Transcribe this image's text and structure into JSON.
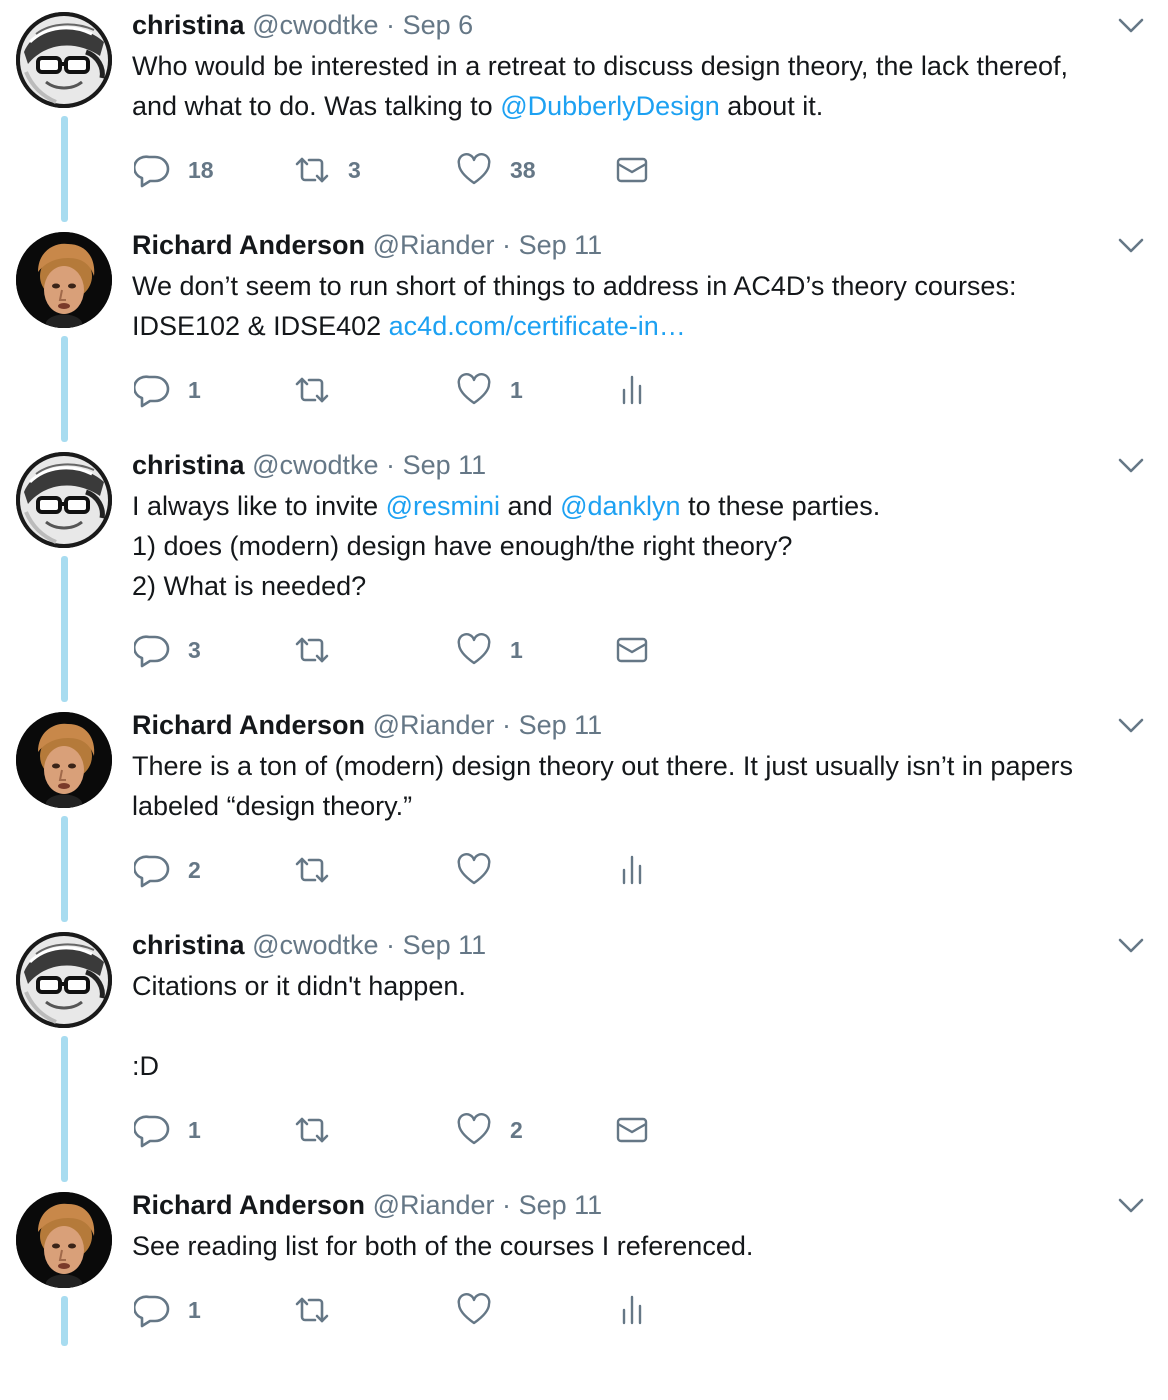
{
  "tweets": [
    {
      "avatar": "christina",
      "name": "christina",
      "handle": "@cwodtke",
      "sep": "·",
      "date": "Sep 6",
      "lines": [
        [
          {
            "t": "Who would be interested in a retreat to discuss design theory, the lack thereof,"
          }
        ],
        [
          {
            "t": "and what to do. Was talking to "
          },
          {
            "t": "@DubberlyDesign",
            "link": true
          },
          {
            "t": " about it."
          }
        ]
      ],
      "reply_count": "18",
      "retweet_count": "3",
      "like_count": "38",
      "last_action": "mail-icon"
    },
    {
      "avatar": "richard",
      "name": "Richard Anderson",
      "handle": "@Riander",
      "sep": "·",
      "date": "Sep 11",
      "lines": [
        [
          {
            "t": "We don’t seem to run short of things to address in AC4D’s theory courses:"
          }
        ],
        [
          {
            "t": "IDSE102 & IDSE402 "
          },
          {
            "t": "ac4d.com/certificate-in…",
            "link": true
          }
        ]
      ],
      "reply_count": "1",
      "retweet_count": "",
      "like_count": "1",
      "last_action": "analytics-icon"
    },
    {
      "avatar": "christina",
      "name": "christina",
      "handle": "@cwodtke",
      "sep": "·",
      "date": "Sep 11",
      "lines": [
        [
          {
            "t": "I always like to invite "
          },
          {
            "t": "@resmini",
            "link": true
          },
          {
            "t": " and "
          },
          {
            "t": "@danklyn",
            "link": true
          },
          {
            "t": " to these parties."
          }
        ],
        [
          {
            "t": "1) does (modern) design have enough/the right theory?"
          }
        ],
        [
          {
            "t": "2) What is needed?"
          }
        ]
      ],
      "reply_count": "3",
      "retweet_count": "",
      "like_count": "1",
      "last_action": "mail-icon"
    },
    {
      "avatar": "richard",
      "name": "Richard Anderson",
      "handle": "@Riander",
      "sep": "·",
      "date": "Sep 11",
      "lines": [
        [
          {
            "t": "There is a ton of (modern) design theory out there. It just usually isn’t in papers"
          }
        ],
        [
          {
            "t": "labeled “design theory.”"
          }
        ]
      ],
      "reply_count": "2",
      "retweet_count": "",
      "like_count": "",
      "last_action": "analytics-icon"
    },
    {
      "avatar": "christina",
      "name": "christina",
      "handle": "@cwodtke",
      "sep": "·",
      "date": "Sep 11",
      "lines": [
        [
          {
            "t": "Citations or it didn't happen."
          }
        ],
        [
          {
            "t": ""
          }
        ],
        [
          {
            "t": ":D"
          }
        ]
      ],
      "reply_count": "1",
      "retweet_count": "",
      "like_count": "2",
      "last_action": "mail-icon"
    },
    {
      "avatar": "richard",
      "name": "Richard Anderson",
      "handle": "@Riander",
      "sep": "·",
      "date": "Sep 11",
      "lines": [
        [
          {
            "t": "See reading list for both of the courses I referenced."
          }
        ]
      ],
      "reply_count": "1",
      "retweet_count": "",
      "like_count": "",
      "last_action": "analytics-icon"
    }
  ]
}
